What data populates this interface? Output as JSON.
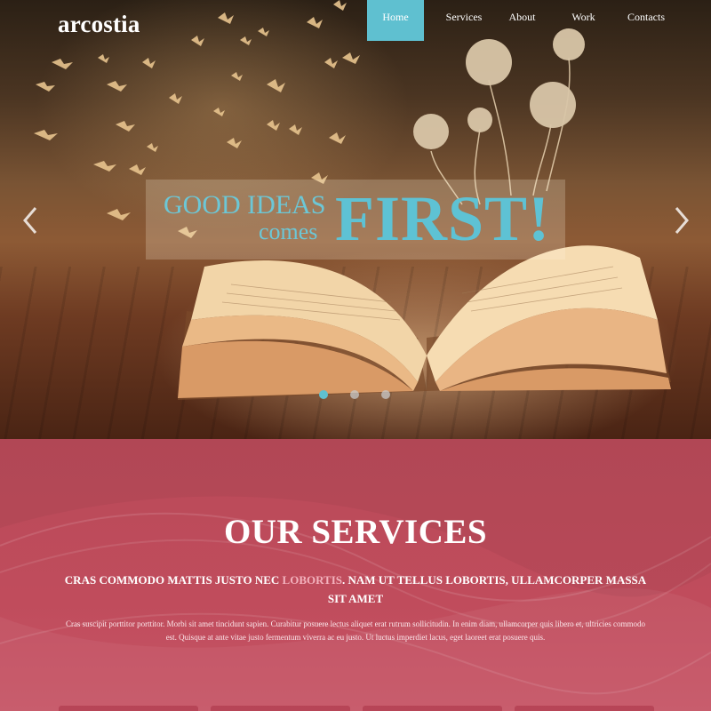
{
  "brand": {
    "logo": "arcostia"
  },
  "nav": [
    {
      "label": "Home",
      "active": true
    },
    {
      "label": "Services",
      "active": false
    },
    {
      "label": "About",
      "active": false
    },
    {
      "label": "Work",
      "active": false
    },
    {
      "label": "Contacts",
      "active": false
    }
  ],
  "slider": {
    "caption_line1": "GOOD IDEAS",
    "caption_line2": "comes",
    "caption_big": "FIRST!",
    "slide_count": 3,
    "active_slide": 1
  },
  "services": {
    "title": "OUR SERVICES",
    "subtitle_part1": "CRAS COMMODO MATTIS JUSTO NEC ",
    "subtitle_highlight": "LOBORTIS",
    "subtitle_part2": ". NAM UT TELLUS LOBORTIS, ULLAMCORPER MASSA SIT AMET",
    "body": "Cras suscipit porttitor porttitor. Morbi sit amet tincidunt sapien. Curabitur posuere lectus aliquet erat rutrum sollicitudin. In enim diam, ullamcorper quis libero et, ultricies commodo est. Quisque at ante vitae justo fermentum viverra ac eu justo. Ut luctus imperdiet lacus, eget laoreet erat posuere quis."
  },
  "colors": {
    "accent": "#5fc0d0",
    "services_bg": "#b94a59",
    "highlight": "#f3b2bd"
  }
}
